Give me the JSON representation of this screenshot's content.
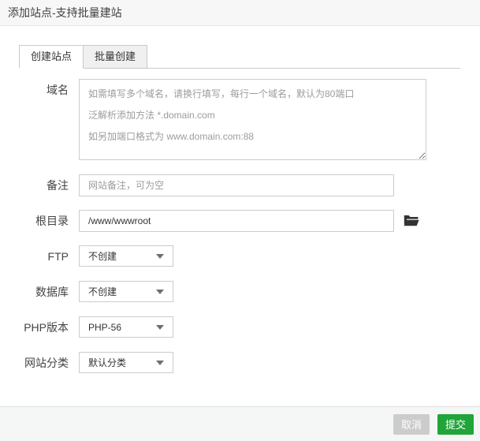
{
  "dialog": {
    "title": "添加站点-支持批量建站"
  },
  "tabs": [
    {
      "label": "创建站点",
      "active": true
    },
    {
      "label": "批量创建",
      "active": false
    }
  ],
  "form": {
    "domain": {
      "label": "域名",
      "placeholder": "如需填写多个域名，请换行填写，每行一个域名，默认为80端口\n泛解析添加方法 *.domain.com\n如另加端口格式为 www.domain.com:88"
    },
    "note": {
      "label": "备注",
      "placeholder": "网站备注，可为空"
    },
    "root": {
      "label": "根目录",
      "value": "/www/wwwroot",
      "icon": "folder-open-icon"
    },
    "ftp": {
      "label": "FTP",
      "value": "不创建"
    },
    "database": {
      "label": "数据库",
      "value": "不创建"
    },
    "php": {
      "label": "PHP版本",
      "value": "PHP-56"
    },
    "category": {
      "label": "网站分类",
      "value": "默认分类"
    }
  },
  "footer": {
    "cancel_label": "取消",
    "submit_label": "提交"
  },
  "colors": {
    "accent_green": "#20a53a",
    "cancel_gray": "#cccccc",
    "titlebar_bg": "#f7f7f7",
    "border": "#cccccc"
  }
}
